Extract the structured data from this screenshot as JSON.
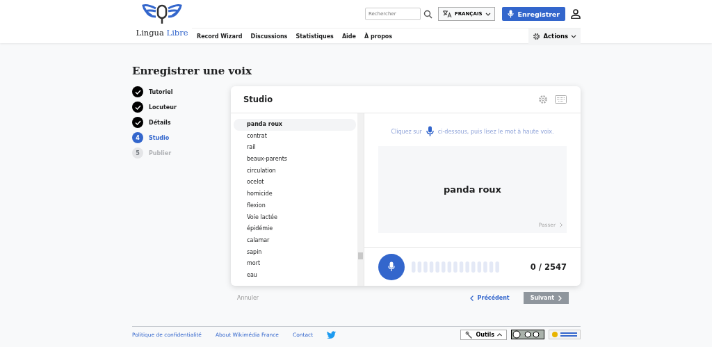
{
  "header": {
    "logo_text": [
      "Lingua",
      "Libre"
    ],
    "search": {
      "placeholder": "Rechercher"
    },
    "language": "FRANÇAIS",
    "record_button": "Enregistrer",
    "nav": [
      "Record Wizard",
      "Discussions",
      "Statistiques",
      "Aide",
      "À propos"
    ],
    "actions": "Actions"
  },
  "page_title": "Enregistrer une voix",
  "steps": [
    {
      "label": "Tutoriel",
      "kind": "done"
    },
    {
      "label": "Locuteur",
      "kind": "done"
    },
    {
      "label": "Détails",
      "kind": "done"
    },
    {
      "number": "4",
      "label": "Studio",
      "kind": "current"
    },
    {
      "number": "5",
      "label": "Publier",
      "kind": "pending"
    }
  ],
  "studio": {
    "title": "Studio",
    "words": [
      {
        "text": "panda roux",
        "selected": true
      },
      {
        "text": "contrat",
        "selected": false
      },
      {
        "text": "rail",
        "selected": false
      },
      {
        "text": "beaux-parents",
        "selected": false
      },
      {
        "text": "circulation",
        "selected": false
      },
      {
        "text": "ocelot",
        "selected": false
      },
      {
        "text": "homicide",
        "selected": false
      },
      {
        "text": "flexion",
        "selected": false
      },
      {
        "text": "Voie lactée",
        "selected": false
      },
      {
        "text": "épidémie",
        "selected": false
      },
      {
        "text": "calamar",
        "selected": false
      },
      {
        "text": "sapin",
        "selected": false
      },
      {
        "text": "mort",
        "selected": false
      },
      {
        "text": "eau",
        "selected": false
      }
    ],
    "instruction_before": "Cliquez sur",
    "instruction_after": "ci-dessous, puis lisez le mot à haute voix.",
    "current_word": "panda roux",
    "skip": "Passer",
    "counter": "0 / 2547"
  },
  "cancel": "Annuler",
  "previous": "Précédent",
  "next": {
    "label": "Suivant",
    "disabled": true
  },
  "footer": {
    "links": [
      "Politique de confidentialité",
      "About Wikimédia France",
      "Contact"
    ],
    "tools": "Outils"
  }
}
